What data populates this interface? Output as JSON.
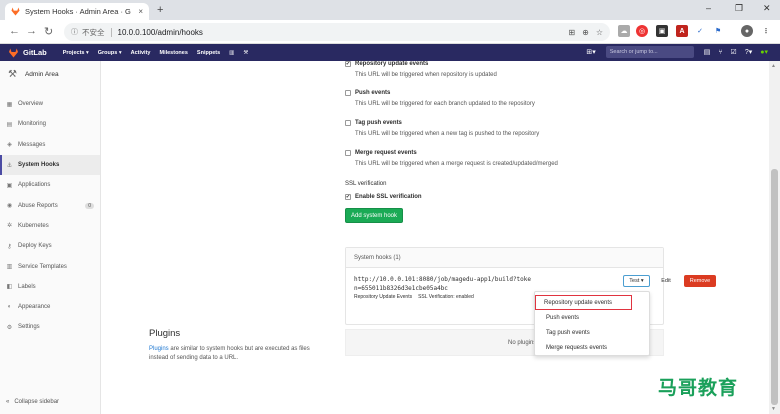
{
  "browser": {
    "tab_title": "System Hooks · Admin Area · G",
    "tab_close": "×",
    "new_tab": "+",
    "insecure_label": "不安全",
    "url": "10.0.0.100/admin/hooks",
    "window_min": "–",
    "window_max": "❐",
    "window_close": "✕"
  },
  "gitlab": {
    "brand": "GitLab",
    "nav": [
      "Projects ▾",
      "Groups ▾",
      "Activity",
      "Milestones",
      "Snippets"
    ],
    "search_placeholder": "Search or jump to..."
  },
  "sidebar": {
    "title": "Admin Area",
    "items": [
      {
        "label": "Overview",
        "icon": "overview-icon",
        "glyph": "▦"
      },
      {
        "label": "Monitoring",
        "icon": "monitoring-icon",
        "glyph": "▤"
      },
      {
        "label": "Messages",
        "icon": "messages-icon",
        "glyph": "◈"
      },
      {
        "label": "System Hooks",
        "icon": "hook-icon",
        "glyph": "⚓"
      },
      {
        "label": "Applications",
        "icon": "applications-icon",
        "glyph": "▣"
      },
      {
        "label": "Abuse Reports",
        "icon": "abuse-icon",
        "glyph": "◉",
        "count": "0"
      },
      {
        "label": "Kubernetes",
        "icon": "kubernetes-icon",
        "glyph": "✲"
      },
      {
        "label": "Deploy Keys",
        "icon": "key-icon",
        "glyph": "⚷"
      },
      {
        "label": "Service Templates",
        "icon": "template-icon",
        "glyph": "▥"
      },
      {
        "label": "Labels",
        "icon": "label-icon",
        "glyph": "◧"
      },
      {
        "label": "Appearance",
        "icon": "appearance-icon",
        "glyph": "◐"
      },
      {
        "label": "Settings",
        "icon": "settings-icon",
        "glyph": "⚙"
      }
    ],
    "collapse_label": "Collapse sidebar"
  },
  "events": [
    {
      "label": "Repository update events",
      "desc": "This URL will be triggered when repository is updated",
      "checked": true
    },
    {
      "label": "Push events",
      "desc": "This URL will be triggered for each branch updated to the repository",
      "checked": false
    },
    {
      "label": "Tag push events",
      "desc": "This URL will be triggered when a new tag is pushed to the repository",
      "checked": false
    },
    {
      "label": "Merge request events",
      "desc": "This URL will be triggered when a merge request is created/updated/merged",
      "checked": false
    }
  ],
  "ssl": {
    "section_label": "SSL verification",
    "checkbox_label": "Enable SSL verification",
    "checked": true
  },
  "add_button": "Add system hook",
  "hooks": {
    "header": "System hooks (1)",
    "url": "http://10.0.0.101:8080/job/magedu-app1/build?token=655011b8326d3e1cbe05a4bc",
    "tags": [
      "Repository Update Events",
      "SSL Verification: enabled"
    ],
    "test_label": "Test ▾",
    "edit_label": "Edit",
    "remove_label": "Remove"
  },
  "test_dropdown": [
    "Repository update events",
    "Push events",
    "Tag push events",
    "Merge requests events"
  ],
  "plugins": {
    "title": "Plugins",
    "link": "Plugins",
    "desc": " are similar to system hooks but are executed as files instead of sending data to a URL.",
    "empty": "No plugins"
  },
  "watermark": "马哥教育",
  "colors": {
    "header": "#292961",
    "add_button": "#1aaa55",
    "remove_button": "#db3b21",
    "highlight": "#e0333f"
  }
}
